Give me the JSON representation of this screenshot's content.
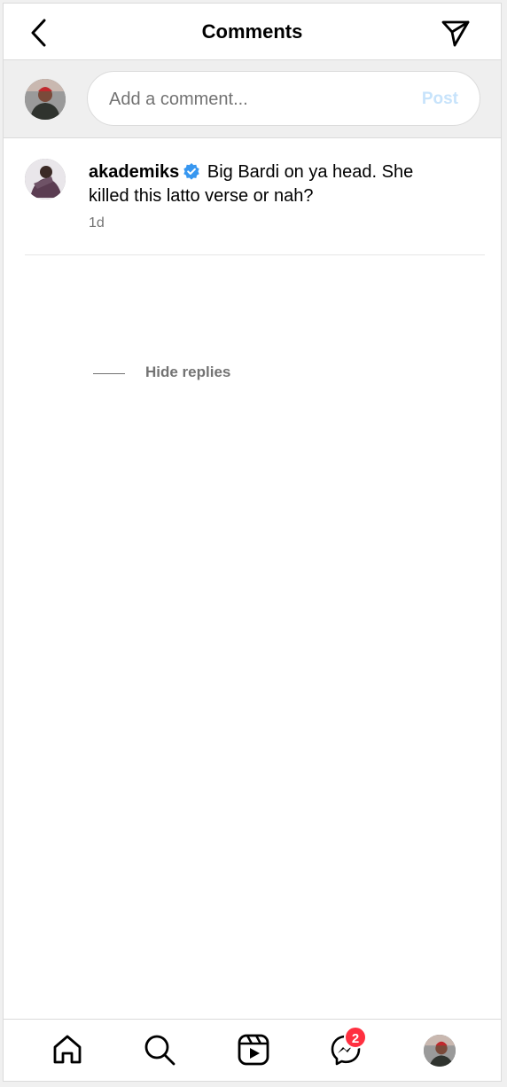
{
  "header": {
    "title": "Comments",
    "back_icon": "chevron-left-icon",
    "send_icon": "paper-plane-icon"
  },
  "compose": {
    "placeholder": "Add a comment...",
    "value": "",
    "post_label": "Post",
    "post_color": "#c7e3fb"
  },
  "comment": {
    "username": "akademiks",
    "verified": true,
    "text": "Big Bardi on ya head. She killed this latto verse or nah?",
    "time": "1d"
  },
  "replies": {
    "label": "Hide replies"
  },
  "bottom_nav": {
    "items": [
      {
        "name": "home-icon"
      },
      {
        "name": "search-icon"
      },
      {
        "name": "reels-icon"
      },
      {
        "name": "messenger-icon",
        "badge": "2"
      },
      {
        "name": "profile-avatar"
      }
    ],
    "badge_color": "#ff3040"
  },
  "colors": {
    "verified": "#3897f0",
    "secondary_text": "#737373"
  }
}
